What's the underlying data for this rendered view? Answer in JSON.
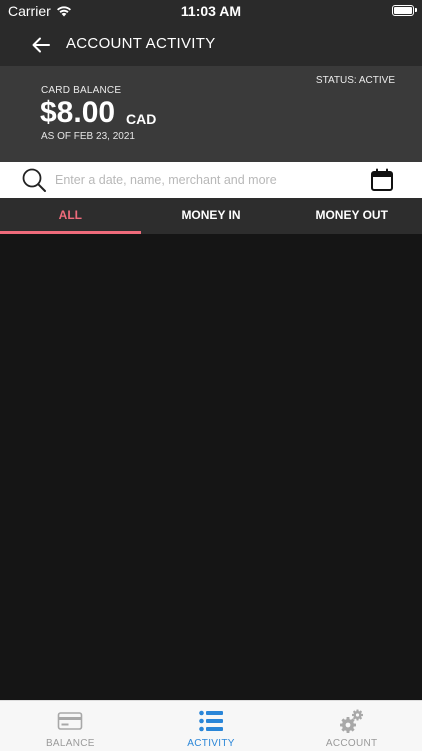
{
  "status_bar": {
    "carrier": "Carrier",
    "time": "11:03 AM"
  },
  "header": {
    "title": "ACCOUNT ACTIVITY"
  },
  "balance": {
    "label": "CARD BALANCE",
    "amount": "$8.00",
    "currency": "CAD",
    "as_of": "AS OF FEB 23, 2021",
    "status": "STATUS: ACTIVE"
  },
  "search": {
    "placeholder": "Enter a date, name, merchant and more",
    "value": ""
  },
  "tabs": [
    {
      "label": "ALL",
      "active": true
    },
    {
      "label": "MONEY IN",
      "active": false
    },
    {
      "label": "MONEY OUT",
      "active": false
    }
  ],
  "tabbar": [
    {
      "label": "BALANCE",
      "icon": "card-icon",
      "active": false
    },
    {
      "label": "ACTIVITY",
      "icon": "list-icon",
      "active": true
    },
    {
      "label": "ACCOUNT",
      "icon": "gears-icon",
      "active": false
    }
  ],
  "colors": {
    "accent": "#ef6b7b",
    "tab_active": "#2a86d8",
    "header_bg": "#2a2a2a",
    "balance_bg": "#3a3a3a",
    "content_bg": "#151515"
  }
}
